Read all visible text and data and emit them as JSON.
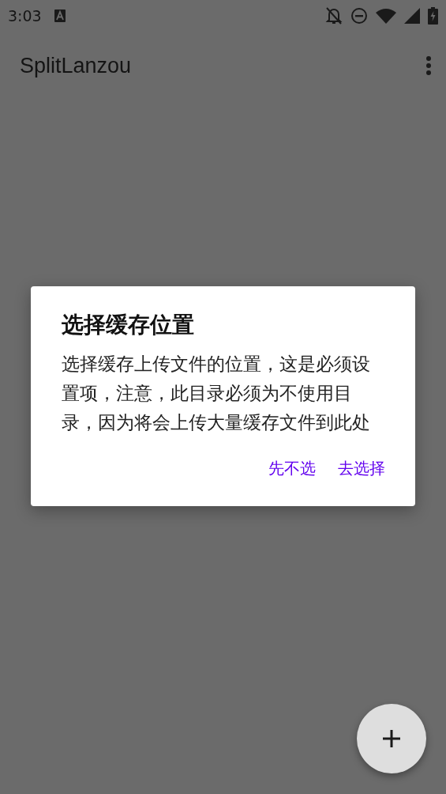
{
  "status_bar": {
    "time": "3:03"
  },
  "app_bar": {
    "title": "SplitLanzou"
  },
  "dialog": {
    "title": "选择缓存位置",
    "message": "选择缓存上传文件的位置，这是必须设置项，注意，此目录必须为不使用目录，因为将会上传大量缓存文件到此处",
    "buttons": [
      "先不选",
      "去选择"
    ]
  }
}
